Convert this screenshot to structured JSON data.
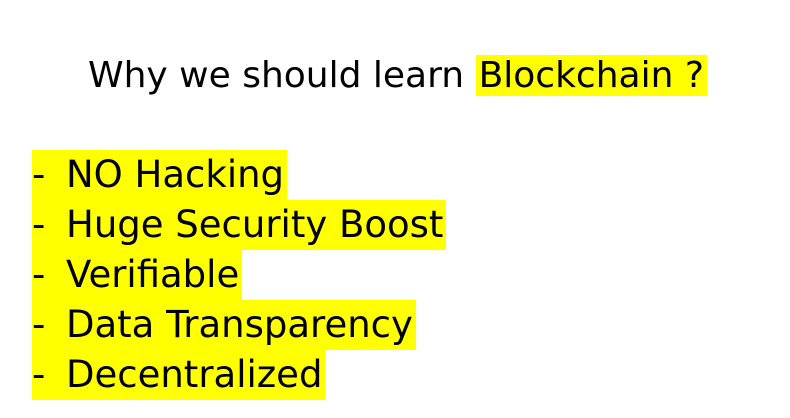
{
  "heading": {
    "prefix": "Why we should learn",
    "highlight": "Blockchain ?"
  },
  "bullets": [
    {
      "dash": "-",
      "text": "NO Hacking"
    },
    {
      "dash": "-",
      "text": "Huge Security Boost"
    },
    {
      "dash": "-",
      "text": "Verifiable"
    },
    {
      "dash": "-",
      "text": "Data Transparency"
    },
    {
      "dash": "-",
      "text": "Decentralized"
    }
  ],
  "colors": {
    "highlight": "#ffff00",
    "text": "#000000",
    "background": "#ffffff"
  }
}
